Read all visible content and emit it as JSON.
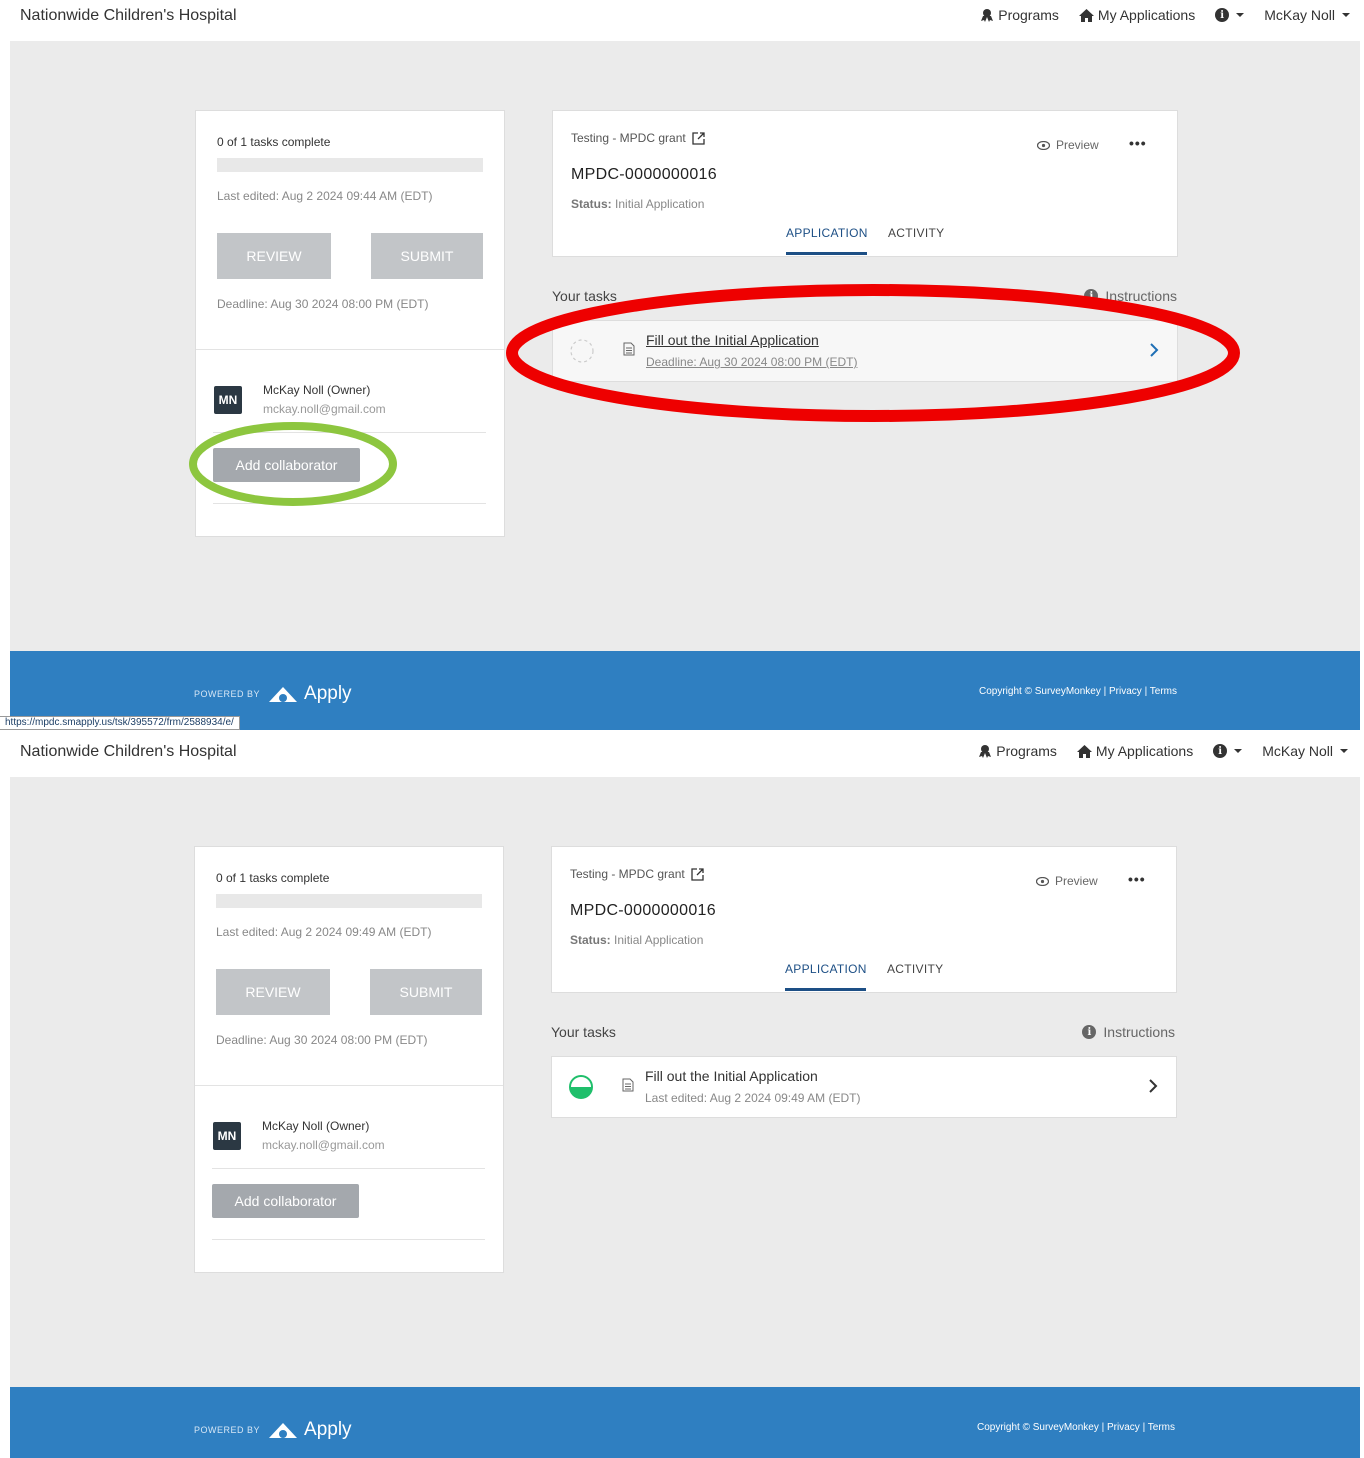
{
  "colors": {
    "footer": "#2f7fc1",
    "annotation_red": "#ee0000",
    "annotation_green": "#8dc63f",
    "task_done_green": "#1fbf6b"
  },
  "status_url": "https://mpdc.smapply.us/tsk/395572/frm/2588934/e/",
  "screens": [
    {
      "header": {
        "brand": "Nationwide Children's Hospital",
        "programs": "Programs",
        "my_applications": "My Applications",
        "user": "McKay Noll"
      },
      "left": {
        "tasks_complete": "0 of 1 tasks complete",
        "progress": 0,
        "last_edited": "Last edited: Aug 2 2024 09:44 AM (EDT)",
        "review": "REVIEW",
        "submit": "SUBMIT",
        "deadline": "Deadline: Aug 30 2024 08:00 PM (EDT)",
        "avatar": "MN",
        "owner": "McKay Noll (Owner)",
        "email": "mckay.noll@gmail.com",
        "add_collaborator": "Add collaborator"
      },
      "app": {
        "grant": "Testing - MPDC grant",
        "id": "MPDC-0000000016",
        "status_label": "Status:",
        "status_value": "Initial Application",
        "preview": "Preview",
        "tab_application": "APPLICATION",
        "tab_activity": "ACTIVITY"
      },
      "tasks": {
        "heading": "Your tasks",
        "instructions": "Instructions",
        "task_title": "Fill out the Initial Application",
        "task_sub": "Deadline: Aug 30 2024 08:00 PM (EDT)",
        "task_state": "not-started"
      },
      "footer": {
        "powered_by": "POWERED BY",
        "apply": "Apply",
        "copyright": "Copyright © SurveyMonkey | Privacy | Terms"
      }
    },
    {
      "header": {
        "brand": "Nationwide Children's Hospital",
        "programs": "Programs",
        "my_applications": "My Applications",
        "user": "McKay Noll"
      },
      "left": {
        "tasks_complete": "0 of 1 tasks complete",
        "progress": 0,
        "last_edited": "Last edited: Aug 2 2024 09:49 AM (EDT)",
        "review": "REVIEW",
        "submit": "SUBMIT",
        "deadline": "Deadline: Aug 30 2024 08:00 PM (EDT)",
        "avatar": "MN",
        "owner": "McKay Noll (Owner)",
        "email": "mckay.noll@gmail.com",
        "add_collaborator": "Add collaborator"
      },
      "app": {
        "grant": "Testing - MPDC grant",
        "id": "MPDC-0000000016",
        "status_label": "Status:",
        "status_value": "Initial Application",
        "preview": "Preview",
        "tab_application": "APPLICATION",
        "tab_activity": "ACTIVITY"
      },
      "tasks": {
        "heading": "Your tasks",
        "instructions": "Instructions",
        "task_title": "Fill out the Initial Application",
        "task_sub": "Last edited: Aug 2 2024 09:49 AM (EDT)",
        "task_state": "in-progress"
      },
      "footer": {
        "powered_by": "POWERED BY",
        "apply": "Apply",
        "copyright": "Copyright © SurveyMonkey | Privacy | Terms"
      }
    }
  ]
}
